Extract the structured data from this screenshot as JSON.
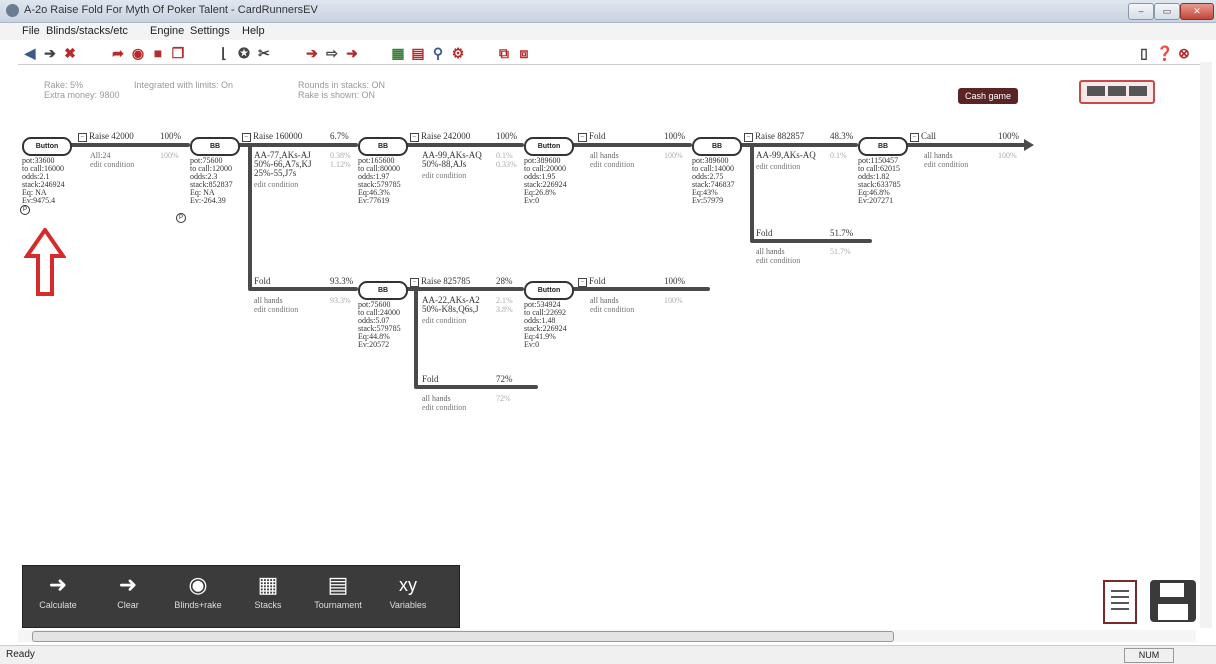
{
  "window": {
    "title": "A-2o Raise Fold For Myth Of Poker Talent - CardRunnersEV",
    "minimize": "–",
    "maximize": "▭",
    "close": "✕"
  },
  "menu": [
    "File",
    "Blinds/stacks/etc",
    "Engine",
    "Settings",
    "Help"
  ],
  "top_info": {
    "left_line1": "Rake: 5%",
    "left_line2": "Extra money: 9800",
    "mid_line1": "Integrated with limits: On",
    "mid_line2": "",
    "right_line1": "Rounds in stacks: ON",
    "right_line2": "Rake is shown: ON"
  },
  "cash_game_label": "Cash game",
  "tree": {
    "root": {
      "node_label": "Button",
      "stats": "pot:33600\nto call:16000\nodds:2.1\nstack:246924\nEq: NA\nEv:9475.4",
      "p_marker": "P"
    },
    "b1": {
      "action": "Raise 42000",
      "pct": "100%",
      "sub": "All:24",
      "cond": "edit condition",
      "faint": "100%"
    },
    "n1": {
      "node_label": "BB",
      "stats": "pot:75600\nto call:12000\nodds:2.3\nstack:852837\nEq: NA\nEv:-264.39",
      "p_marker": "P"
    },
    "b2": {
      "action": "Raise 160000",
      "pct": "6.7%",
      "sub": "AA-77,AKs-AJ\n50%-66,A7s,KJ\n25%-55,J7s",
      "cond": "edit condition",
      "faint": "0.38%\n1.12%"
    },
    "n2": {
      "node_label": "BB",
      "stats": "pot:165600\nto call:80000\nodds:1.97\nstack:579785\nEq:46.3%\nEv:77619"
    },
    "b3": {
      "action": "Raise 242000",
      "pct": "100%",
      "sub": "AA-99,AKs-AQ\n50%-88,AJs",
      "cond": "edit condition",
      "faint": "0.1%\n0.33%"
    },
    "n3": {
      "node_label": "Button",
      "stats": "pot:389600\nto call:20000\nodds:1.95\nstack:226924\nEq:26.8%\nEv:0"
    },
    "b4": {
      "action": "Fold",
      "pct": "100%",
      "sub": "all hands",
      "cond": "edit condition",
      "faint": "100%"
    },
    "n4": {
      "node_label": "BB",
      "stats": "pot:389600\nto call:14000\nodds:2.75\nstack:746837\nEq:43%\nEv:57979"
    },
    "b5": {
      "action": "Raise 882857",
      "pct": "48.3%",
      "sub": "AA-99,AKs-AQ",
      "cond": "edit condition",
      "faint": "0.1%"
    },
    "n5": {
      "node_label": "BB",
      "stats": "pot:1150457\nto call:62015\nodds:1.82\nstack:633785\nEq:46.8%\nEv:207271"
    },
    "b6": {
      "action": "Call",
      "pct": "100%",
      "sub": "all hands",
      "cond": "edit condition",
      "faint": "100%"
    },
    "b7": {
      "action": "Fold",
      "pct": "51.7%",
      "sub": "all hands",
      "cond": "edit condition",
      "faint": "51.7%"
    },
    "b8": {
      "action": "Fold",
      "pct": "93.3%",
      "sub": "all hands",
      "cond": "edit condition",
      "faint": "93.3%"
    },
    "n6": {
      "node_label": "BB",
      "stats": "pot:75600\nto call:24000\nodds:5.07\nstack:579785\nEq:44.8%\nEv:20572"
    },
    "b9": {
      "action": "Raise 825785",
      "pct": "28%",
      "sub": "AA-22,AKs-A2\n50%-K8s,Q6s,J",
      "cond": "edit condition",
      "faint": "2.1%\n3.8%"
    },
    "n7": {
      "node_label": "Button",
      "stats": "pot:534924\nto call:22692\nodds:1.48\nstack:226924\nEq:41.9%\nEv:0"
    },
    "b10": {
      "action": "Fold",
      "pct": "100%",
      "sub": "all hands",
      "cond": "edit condition",
      "faint": "100%"
    },
    "b11": {
      "action": "Fold",
      "pct": "72%",
      "sub": "all hands",
      "cond": "edit condition",
      "faint": "72%"
    }
  },
  "bottom_toolbar": [
    {
      "label": "Calculate",
      "icon": "calculate-ev-icon",
      "glyph": "➜"
    },
    {
      "label": "Clear",
      "icon": "clear-arrow-icon",
      "glyph": "➜"
    },
    {
      "label": "Blinds+rake",
      "icon": "blinds-rake-icon",
      "glyph": "◉"
    },
    {
      "label": "Stacks",
      "icon": "stacks-icon",
      "glyph": "▦"
    },
    {
      "label": "Tournament",
      "icon": "tournament-icon",
      "glyph": "▤"
    },
    {
      "label": "Variables",
      "icon": "variables-xy-icon",
      "glyph": "xy"
    }
  ],
  "status": {
    "text": "Ready",
    "num": "NUM"
  },
  "colors": {
    "accent_red": "#c62828",
    "line": "#4a4a4a",
    "dark_panel": "#3b3b3b",
    "cash_button": "#5a2424"
  }
}
